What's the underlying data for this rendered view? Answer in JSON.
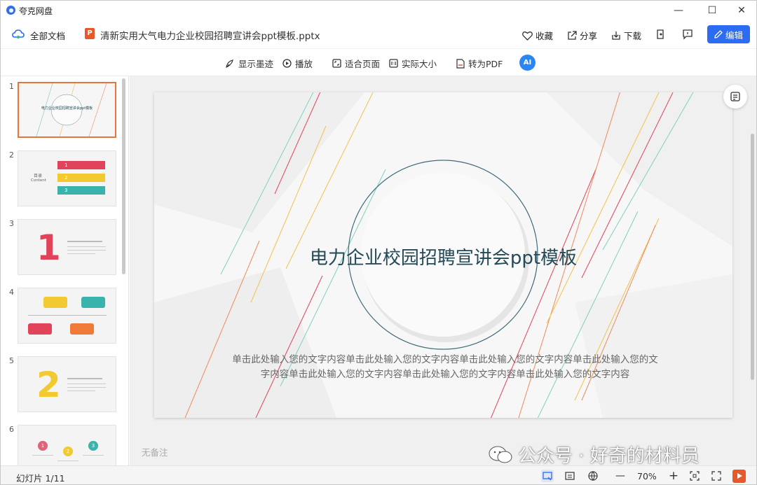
{
  "app": {
    "name": "夸克网盘"
  },
  "window_controls": {
    "minimize": "—",
    "maximize": "☐",
    "close": "✕"
  },
  "header": {
    "breadcrumb": "全部文档",
    "file_name": "清新实用大气电力企业校园招聘宣讲会ppt模板.pptx",
    "file_badge": "P",
    "favorite": "收藏",
    "share": "分享",
    "download": "下载",
    "edit": "编辑"
  },
  "toolbar": {
    "show_ink": "显示墨迹",
    "play": "播放",
    "fit_page": "适合页面",
    "actual_size": "实际大小",
    "to_pdf": "转为PDF",
    "ai": "AI"
  },
  "thumbnails": [
    {
      "num": "1",
      "caption": "电力企业校园招聘宣讲会ppt模板"
    },
    {
      "num": "2",
      "caption_left": "目录",
      "caption_left2": "Content",
      "items": [
        "1",
        "2",
        "3"
      ]
    },
    {
      "num": "3",
      "big": "1"
    },
    {
      "num": "4"
    },
    {
      "num": "5",
      "big": "2"
    },
    {
      "num": "6",
      "items": [
        "1",
        "2",
        "3"
      ]
    }
  ],
  "slide": {
    "title": "电力企业校园招聘宣讲会ppt模板",
    "body_line1": "单击此处输入您的文字内容单击此处输入您的文字内容单击此处输入您的文字内容单击此处输入您的文",
    "body_line2": "字内容单击此处输入您的文字内容单击此处输入您的文字内容单击此处输入您的文字内容"
  },
  "notes": "无备注",
  "watermark": "公众号 · 好奇的材料员",
  "status": {
    "slide_count": "幻灯片 1/11",
    "zoom": "70%",
    "minus": "—",
    "plus": "+"
  },
  "colors": {
    "accent": "#2c6cf2",
    "ppt_orange": "#e8582a",
    "active_border": "#e8743b",
    "title_color": "#234a56"
  }
}
